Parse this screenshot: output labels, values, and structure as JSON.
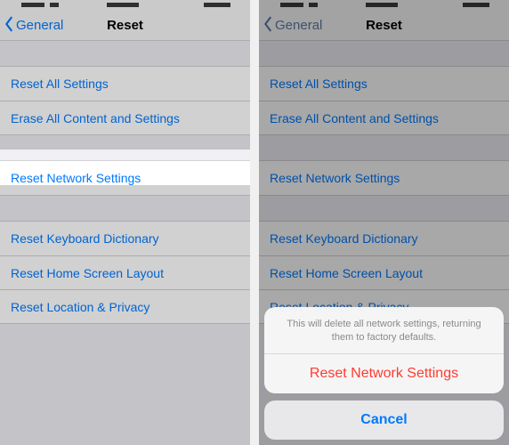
{
  "left": {
    "back_label": "General",
    "title": "Reset",
    "rows": {
      "reset_all": "Reset All Settings",
      "erase_all": "Erase All Content and Settings",
      "reset_network": "Reset Network Settings",
      "reset_keyboard": "Reset Keyboard Dictionary",
      "reset_home": "Reset Home Screen Layout",
      "reset_location": "Reset Location & Privacy"
    }
  },
  "right": {
    "back_label": "General",
    "title": "Reset",
    "rows": {
      "reset_all": "Reset All Settings",
      "erase_all": "Erase All Content and Settings",
      "reset_network": "Reset Network Settings",
      "reset_keyboard": "Reset Keyboard Dictionary",
      "reset_home": "Reset Home Screen Layout",
      "reset_location": "Reset Location & Privacy"
    },
    "sheet": {
      "message": "This will delete all network settings, returning them to factory defaults.",
      "action": "Reset Network Settings",
      "cancel": "Cancel"
    }
  },
  "colors": {
    "tint": "#007aff",
    "destructive": "#ff3b30"
  }
}
